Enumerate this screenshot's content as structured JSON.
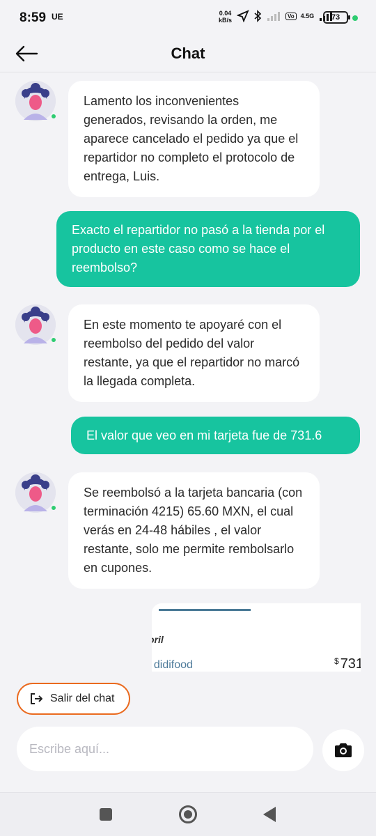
{
  "status_bar": {
    "time": "8:59",
    "carrier": "UE",
    "speed_value": "0.04",
    "speed_unit": "kB/s",
    "network": "4.5G",
    "battery": "73"
  },
  "header": {
    "title": "Chat",
    "back_icon": "arrow-left-icon"
  },
  "messages": [
    {
      "side": "in",
      "text": "Lamento los inconvenientes generados, revisando la orden, me aparece cancelado el pedido ya que el repartidor no completo el protocolo de entrega, Luis."
    },
    {
      "side": "out",
      "text": "Exacto el repartidor no pasó a la tienda por el producto en este caso como se hace el reembolso?"
    },
    {
      "side": "in",
      "text": "En este momento te apoyaré con el reembolso del pedido del valor restante, ya que el repartidor no marcó la llegada completa."
    },
    {
      "side": "out",
      "text": "El valor que veo en mi tarjeta fue de 731.6"
    },
    {
      "side": "in",
      "text": "Se reembolsó a la tarjeta bancaria (con terminación 4215) 65.60 MXN, el cual verás en 24-48 hábiles , el valor restante, solo me permite rembolsarlo en cupones."
    }
  ],
  "attachment_card": {
    "title_fragment": "oril",
    "store_fragment": "t didifood",
    "currency": "$",
    "price_fragment": "731"
  },
  "leave_chat": {
    "label": "Salir del chat",
    "icon": "exit-icon"
  },
  "composer": {
    "placeholder": "Escribe aquí...",
    "camera_icon": "camera-icon"
  },
  "colors": {
    "accent": "#17c49f",
    "leave_border": "#ea6a1f",
    "background": "#f3f3f6"
  }
}
